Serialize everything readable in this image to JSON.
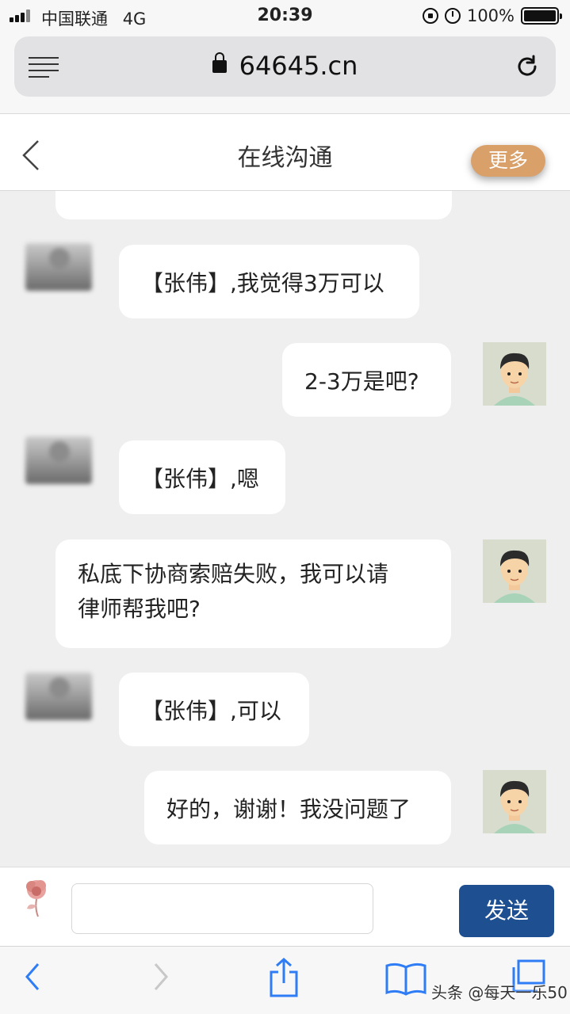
{
  "status_bar": {
    "carrier": "中国联通",
    "network": "4G",
    "time": "20:39",
    "battery": "100%",
    "battery_level": 1.0
  },
  "browser": {
    "url": "64645.cn",
    "menu_icon": "reader-menu-icon",
    "reload_icon": "reload-icon"
  },
  "header": {
    "title": "在线沟通",
    "more_button": "更多",
    "back_icon": "back-chevron-icon"
  },
  "messages": [
    {
      "from": "other",
      "text": "【张伟】,我觉得3万可以"
    },
    {
      "from": "me",
      "text": "2-3万是吧?"
    },
    {
      "from": "other",
      "text": "【张伟】,嗯"
    },
    {
      "from": "me",
      "lines": [
        "私底下协商索赔失败，我可以请",
        "律师帮我吧?"
      ]
    },
    {
      "from": "other",
      "text": "【张伟】,可以"
    },
    {
      "from": "me",
      "text": "好的，谢谢！我没问题了"
    }
  ],
  "composer": {
    "input_value": "",
    "send_button": "发送",
    "rose_icon": "rose-icon"
  },
  "toolbar": {
    "icons": [
      "back-arrow-icon",
      "forward-arrow-icon",
      "share-icon",
      "bookmarks-icon",
      "tabs-icon"
    ],
    "watermark": "头条 @每天一乐50"
  },
  "colors": {
    "send_button": "#1e4f91",
    "more_button": "#d9a06a",
    "chat_background": "#efefef",
    "browser_blue": "#2f7df6"
  }
}
